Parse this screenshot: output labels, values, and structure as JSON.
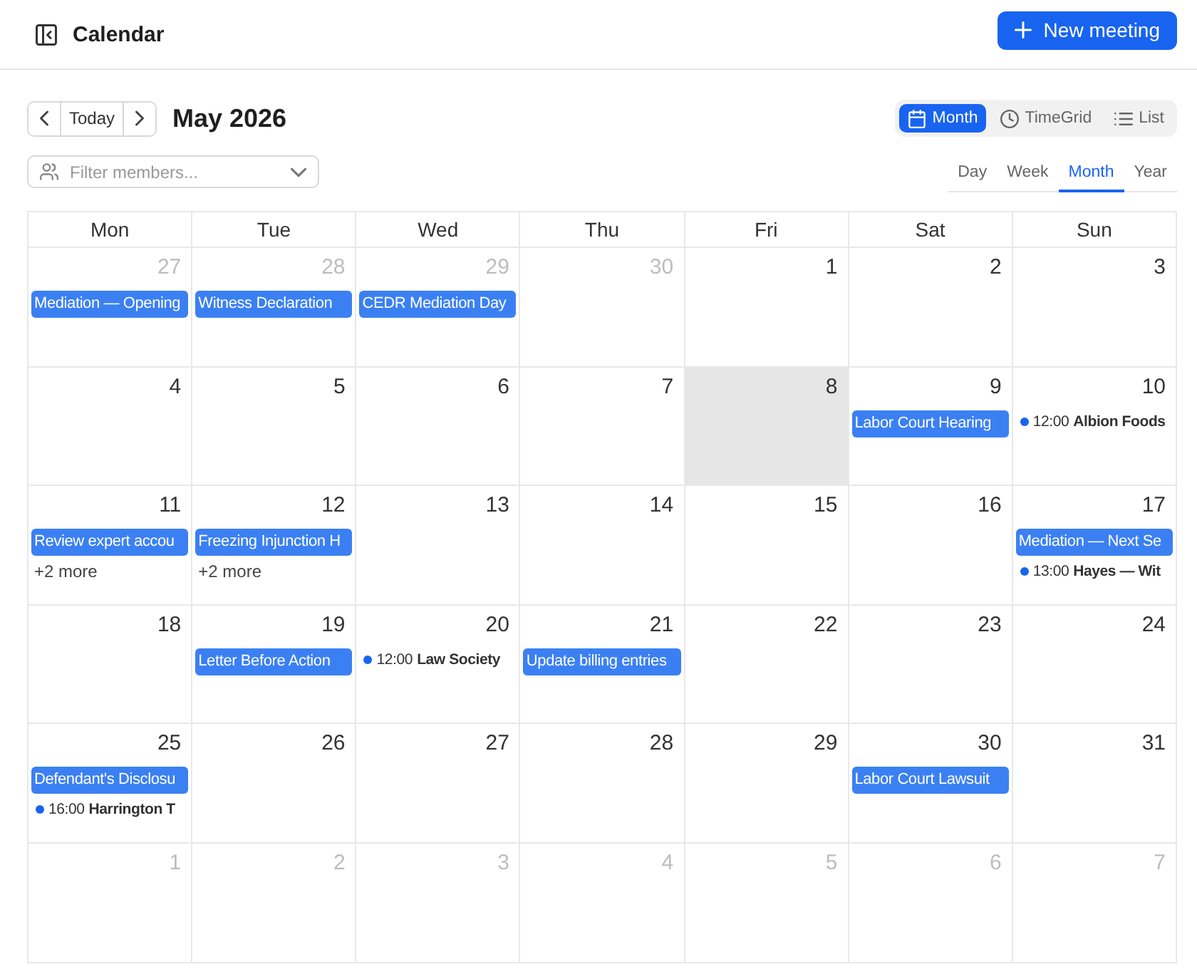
{
  "header": {
    "title": "Calendar",
    "new_button": "New meeting"
  },
  "toolbar": {
    "today": "Today",
    "period": "May 2026",
    "views": [
      {
        "label": "Month",
        "selected": true
      },
      {
        "label": "TimeGrid",
        "selected": false
      },
      {
        "label": "List",
        "selected": false
      }
    ]
  },
  "filter": {
    "placeholder": "Filter members..."
  },
  "tabs": [
    {
      "label": "Day",
      "selected": false
    },
    {
      "label": "Week",
      "selected": false
    },
    {
      "label": "Month",
      "selected": true
    },
    {
      "label": "Year",
      "selected": false
    }
  ],
  "calendar": {
    "weekdays": [
      "Mon",
      "Tue",
      "Wed",
      "Thu",
      "Fri",
      "Sat",
      "Sun"
    ],
    "weeks": [
      {
        "days": [
          {
            "date": "27",
            "outside": true,
            "today": false,
            "events": [
              {
                "kind": "bar",
                "title": "Mediation — Opening"
              }
            ]
          },
          {
            "date": "28",
            "outside": true,
            "today": false,
            "events": [
              {
                "kind": "bar",
                "title": "Witness Declaration"
              }
            ]
          },
          {
            "date": "29",
            "outside": true,
            "today": false,
            "events": [
              {
                "kind": "bar",
                "title": "CEDR Mediation Day"
              }
            ]
          },
          {
            "date": "30",
            "outside": true,
            "today": false
          },
          {
            "date": "1",
            "outside": false,
            "today": false
          },
          {
            "date": "2",
            "outside": false,
            "today": false
          },
          {
            "date": "3",
            "outside": false,
            "today": false
          }
        ]
      },
      {
        "days": [
          {
            "date": "4",
            "outside": false,
            "today": false
          },
          {
            "date": "5",
            "outside": false,
            "today": false
          },
          {
            "date": "6",
            "outside": false,
            "today": false
          },
          {
            "date": "7",
            "outside": false,
            "today": false
          },
          {
            "date": "8",
            "outside": false,
            "today": true
          },
          {
            "date": "9",
            "outside": false,
            "today": false,
            "events": [
              {
                "kind": "bar",
                "title": "Labor Court Hearing"
              }
            ]
          },
          {
            "date": "10",
            "outside": false,
            "today": false,
            "events": [
              {
                "kind": "dot",
                "time": "12:00",
                "title": "Albion Foods"
              }
            ]
          }
        ]
      },
      {
        "days": [
          {
            "date": "11",
            "outside": false,
            "today": false,
            "events": [
              {
                "kind": "bar",
                "title": "Review expert accou"
              }
            ],
            "more": "+2 more"
          },
          {
            "date": "12",
            "outside": false,
            "today": false,
            "events": [
              {
                "kind": "bar",
                "title": "Freezing Injunction H"
              }
            ],
            "more": "+2 more"
          },
          {
            "date": "13",
            "outside": false,
            "today": false
          },
          {
            "date": "14",
            "outside": false,
            "today": false
          },
          {
            "date": "15",
            "outside": false,
            "today": false
          },
          {
            "date": "16",
            "outside": false,
            "today": false
          },
          {
            "date": "17",
            "outside": false,
            "today": false,
            "events": [
              {
                "kind": "bar",
                "title": "Mediation — Next Se"
              },
              {
                "kind": "dot",
                "time": "13:00",
                "title": "Hayes — Wit"
              }
            ]
          }
        ]
      },
      {
        "days": [
          {
            "date": "18",
            "outside": false,
            "today": false
          },
          {
            "date": "19",
            "outside": false,
            "today": false,
            "events": [
              {
                "kind": "bar",
                "title": "Letter Before Action"
              }
            ]
          },
          {
            "date": "20",
            "outside": false,
            "today": false,
            "events": [
              {
                "kind": "dot",
                "time": "12:00",
                "title": "Law Society"
              }
            ]
          },
          {
            "date": "21",
            "outside": false,
            "today": false,
            "events": [
              {
                "kind": "bar",
                "title": "Update billing entries"
              }
            ]
          },
          {
            "date": "22",
            "outside": false,
            "today": false
          },
          {
            "date": "23",
            "outside": false,
            "today": false
          },
          {
            "date": "24",
            "outside": false,
            "today": false
          }
        ]
      },
      {
        "days": [
          {
            "date": "25",
            "outside": false,
            "today": false,
            "events": [
              {
                "kind": "bar",
                "title": "Defendant's Disclosu"
              },
              {
                "kind": "dot",
                "time": "16:00",
                "title": "Harrington T"
              }
            ]
          },
          {
            "date": "26",
            "outside": false,
            "today": false
          },
          {
            "date": "27",
            "outside": false,
            "today": false
          },
          {
            "date": "28",
            "outside": false,
            "today": false
          },
          {
            "date": "29",
            "outside": false,
            "today": false
          },
          {
            "date": "30",
            "outside": false,
            "today": false,
            "events": [
              {
                "kind": "bar",
                "title": "Labor Court Lawsuit"
              }
            ]
          },
          {
            "date": "31",
            "outside": false,
            "today": false
          }
        ]
      },
      {
        "days": [
          {
            "date": "1",
            "outside": true,
            "today": false
          },
          {
            "date": "2",
            "outside": true,
            "today": false
          },
          {
            "date": "3",
            "outside": true,
            "today": false
          },
          {
            "date": "4",
            "outside": true,
            "today": false
          },
          {
            "date": "5",
            "outside": true,
            "today": false
          },
          {
            "date": "6",
            "outside": true,
            "today": false
          },
          {
            "date": "7",
            "outside": true,
            "today": false
          }
        ]
      }
    ]
  }
}
